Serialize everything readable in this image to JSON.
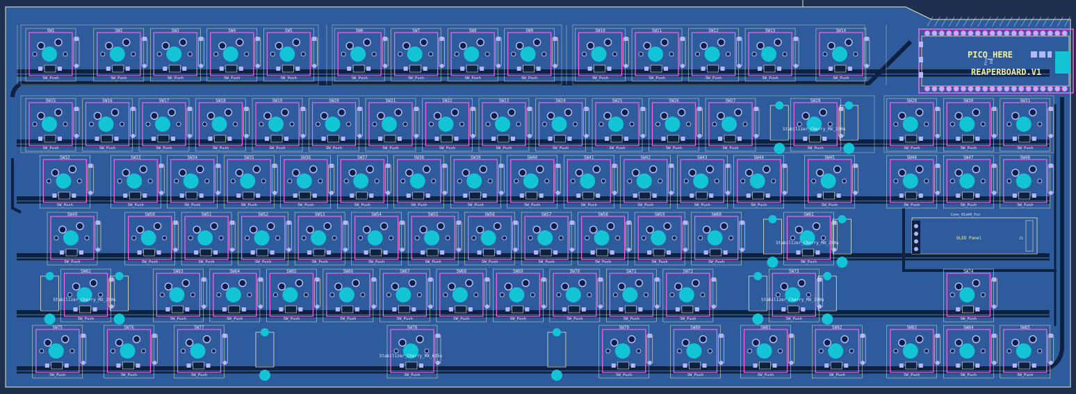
{
  "colors": {
    "background": "#1e2f4f",
    "board": "#2e5b9c",
    "trace": "#0e2140",
    "copper": "#13c3d6",
    "footprint_outline": "#ff62e8",
    "courtyard": "#e8e8c4",
    "silk": "#f2eca8",
    "label": "#e6e6ff",
    "diode_pad": "#b6b6ff"
  },
  "board": {
    "pico_text": "PICO_HERE",
    "board_name": "REAPERBOARD.V1",
    "pico_ref": "Pico",
    "pico_u": "U1",
    "oled_label": "OLED Panel",
    "oled_conn": "Conn_01x04_Pin",
    "oled_ref": "J1",
    "stab_label": "Stabilizer_Cherry_MX_200u",
    "stab_label_625": "Stabilizer_Cherry_MX_625u",
    "switch_value": "SW_Push"
  },
  "switch_rows": [
    [
      {
        "ref": "SW1",
        "col": 0
      },
      {
        "ref": "SW2",
        "col": 1.2
      },
      {
        "ref": "SW3",
        "col": 2.2
      },
      {
        "ref": "SW4",
        "col": 3.2
      },
      {
        "ref": "SW5",
        "col": 4.2
      },
      {
        "ref": "SW6",
        "col": 5.45
      },
      {
        "ref": "SW7",
        "col": 6.45
      },
      {
        "ref": "SW8",
        "col": 7.45
      },
      {
        "ref": "SW9",
        "col": 8.45
      },
      {
        "ref": "SW10",
        "col": 9.7
      },
      {
        "ref": "SW11",
        "col": 10.7
      },
      {
        "ref": "SW12",
        "col": 11.7
      },
      {
        "ref": "SW13",
        "col": 12.7
      },
      {
        "ref": "SW14",
        "col": 13.95
      }
    ],
    [
      {
        "ref": "SW15",
        "col": 0
      },
      {
        "ref": "SW16",
        "col": 1
      },
      {
        "ref": "SW17",
        "col": 2
      },
      {
        "ref": "SW18",
        "col": 3
      },
      {
        "ref": "SW19",
        "col": 4
      },
      {
        "ref": "SW20",
        "col": 5
      },
      {
        "ref": "SW21",
        "col": 6
      },
      {
        "ref": "SW22",
        "col": 7
      },
      {
        "ref": "SW23",
        "col": 8
      },
      {
        "ref": "SW24",
        "col": 9
      },
      {
        "ref": "SW25",
        "col": 10
      },
      {
        "ref": "SW26",
        "col": 11
      },
      {
        "ref": "SW27",
        "col": 12
      },
      {
        "ref": "SW28",
        "col": 13.5,
        "stab": true
      },
      {
        "ref": "SW29",
        "col": 15.2
      },
      {
        "ref": "SW30",
        "col": 16.2
      },
      {
        "ref": "SW31",
        "col": 17.2
      }
    ],
    [
      {
        "ref": "SW32",
        "col": 0.25
      },
      {
        "ref": "SW33",
        "col": 1.5
      },
      {
        "ref": "SW34",
        "col": 2.5
      },
      {
        "ref": "SW35",
        "col": 3.5
      },
      {
        "ref": "SW36",
        "col": 4.5
      },
      {
        "ref": "SW37",
        "col": 5.5
      },
      {
        "ref": "SW38",
        "col": 6.5
      },
      {
        "ref": "SW39",
        "col": 7.5
      },
      {
        "ref": "SW40",
        "col": 8.5
      },
      {
        "ref": "SW41",
        "col": 9.5
      },
      {
        "ref": "SW42",
        "col": 10.5
      },
      {
        "ref": "SW43",
        "col": 11.5
      },
      {
        "ref": "SW44",
        "col": 12.5
      },
      {
        "ref": "SW45",
        "col": 13.75
      },
      {
        "ref": "SW46",
        "col": 15.2
      },
      {
        "ref": "SW47",
        "col": 16.2
      },
      {
        "ref": "SW48",
        "col": 17.2
      }
    ],
    [
      {
        "ref": "SW49",
        "col": 0.38
      },
      {
        "ref": "SW50",
        "col": 1.75
      },
      {
        "ref": "SW51",
        "col": 2.75
      },
      {
        "ref": "SW52",
        "col": 3.75
      },
      {
        "ref": "SW53",
        "col": 4.75
      },
      {
        "ref": "SW54",
        "col": 5.75
      },
      {
        "ref": "SW55",
        "col": 6.75
      },
      {
        "ref": "SW56",
        "col": 7.75
      },
      {
        "ref": "SW57",
        "col": 8.75
      },
      {
        "ref": "SW58",
        "col": 9.75
      },
      {
        "ref": "SW59",
        "col": 10.75
      },
      {
        "ref": "SW60",
        "col": 11.75
      },
      {
        "ref": "SW61",
        "col": 13.38,
        "stab": true
      }
    ],
    [
      {
        "ref": "SW62",
        "col": 0.62,
        "stab": true
      },
      {
        "ref": "SW63",
        "col": 2.25
      },
      {
        "ref": "SW64",
        "col": 3.25
      },
      {
        "ref": "SW65",
        "col": 4.25
      },
      {
        "ref": "SW66",
        "col": 5.25
      },
      {
        "ref": "SW67",
        "col": 6.25
      },
      {
        "ref": "SW68",
        "col": 7.25
      },
      {
        "ref": "SW69",
        "col": 8.25
      },
      {
        "ref": "SW70",
        "col": 9.25
      },
      {
        "ref": "SW71",
        "col": 10.25
      },
      {
        "ref": "SW72",
        "col": 11.25
      },
      {
        "ref": "SW73",
        "col": 13.12,
        "stab": true
      },
      {
        "ref": "SW74",
        "col": 16.2
      }
    ],
    [
      {
        "ref": "SW75",
        "col": 0.12
      },
      {
        "ref": "SW76",
        "col": 1.38
      },
      {
        "ref": "SW77",
        "col": 2.62
      },
      {
        "ref": "SW78",
        "col": 6.38,
        "stab625": true
      },
      {
        "ref": "SW79",
        "col": 10.12
      },
      {
        "ref": "SW80",
        "col": 11.38
      },
      {
        "ref": "SW81",
        "col": 12.62
      },
      {
        "ref": "SW82",
        "col": 13.88
      },
      {
        "ref": "SW83",
        "col": 15.2
      },
      {
        "ref": "SW84",
        "col": 16.2
      },
      {
        "ref": "SW85",
        "col": 17.2
      }
    ]
  ]
}
